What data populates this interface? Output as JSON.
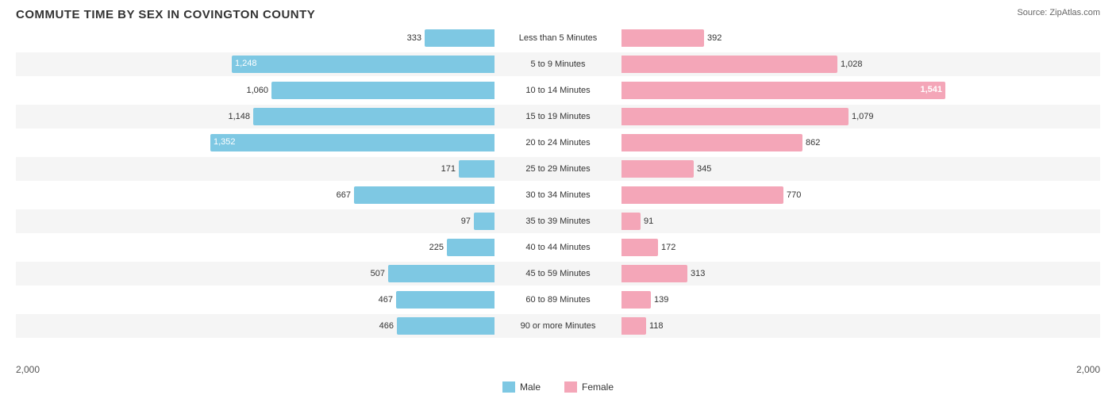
{
  "title": "COMMUTE TIME BY SEX IN COVINGTON COUNTY",
  "source": "Source: ZipAtlas.com",
  "scale_max": 2000,
  "axis_labels": [
    "2,000",
    "2,000"
  ],
  "legend": {
    "male_label": "Male",
    "female_label": "Female"
  },
  "rows": [
    {
      "label": "Less than 5 Minutes",
      "male": 333,
      "female": 392
    },
    {
      "label": "5 to 9 Minutes",
      "male": 1248,
      "female": 1028,
      "male_highlight": true,
      "female_highlight": false
    },
    {
      "label": "10 to 14 Minutes",
      "male": 1060,
      "female": 1541,
      "female_highlight": true
    },
    {
      "label": "15 to 19 Minutes",
      "male": 1148,
      "female": 1079
    },
    {
      "label": "20 to 24 Minutes",
      "male": 1352,
      "female": 862,
      "male_highlight": true
    },
    {
      "label": "25 to 29 Minutes",
      "male": 171,
      "female": 345
    },
    {
      "label": "30 to 34 Minutes",
      "male": 667,
      "female": 770
    },
    {
      "label": "35 to 39 Minutes",
      "male": 97,
      "female": 91
    },
    {
      "label": "40 to 44 Minutes",
      "male": 225,
      "female": 172
    },
    {
      "label": "45 to 59 Minutes",
      "male": 507,
      "female": 313
    },
    {
      "label": "60 to 89 Minutes",
      "male": 467,
      "female": 139
    },
    {
      "label": "90 or more Minutes",
      "male": 466,
      "female": 118
    }
  ]
}
